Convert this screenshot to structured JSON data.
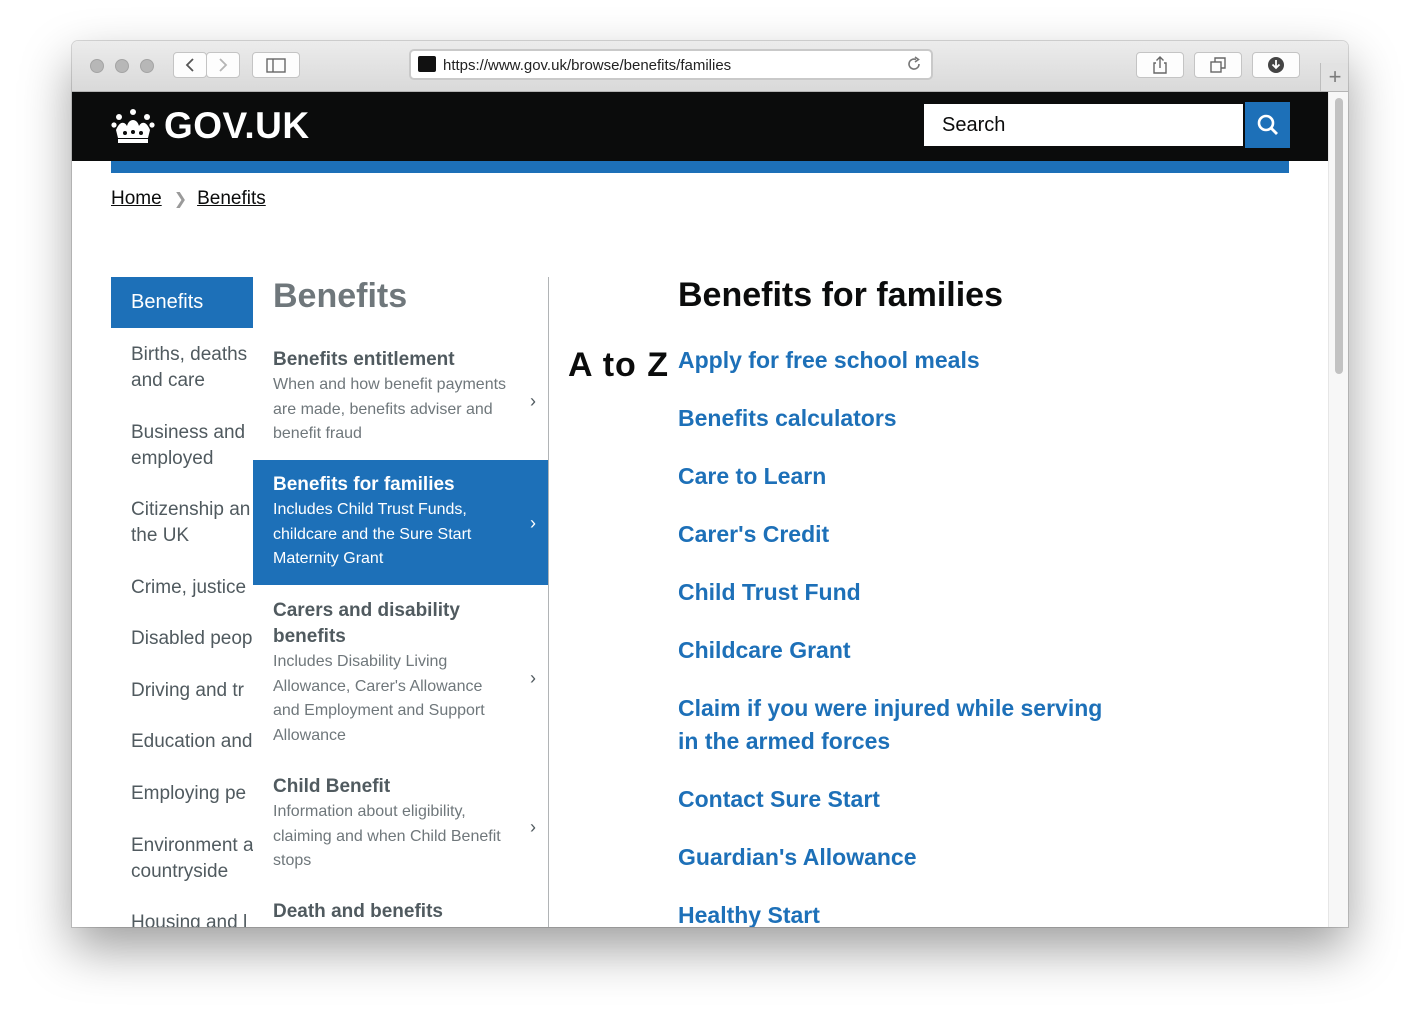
{
  "browser": {
    "url": "https://www.gov.uk/browse/benefits/families"
  },
  "header": {
    "logo_text": "GOV.UK",
    "search_placeholder": "Search"
  },
  "breadcrumb": {
    "items": [
      "Home",
      "Benefits"
    ]
  },
  "col1": {
    "active": "Benefits",
    "items": [
      "Births, deaths\nand care",
      "Business and\nemployed",
      "Citizenship an\nthe UK",
      "Crime, justice",
      "Disabled peop",
      "Driving and tr",
      "Education and",
      "Employing pe",
      "Environment a\ncountryside",
      "Housing and l"
    ]
  },
  "col2": {
    "heading": "Benefits",
    "items": [
      {
        "title": "Benefits entitlement",
        "desc": "When and how benefit payments are made, benefits adviser and benefit fraud"
      },
      {
        "title": "Benefits for families",
        "desc": "Includes Child Trust Funds, childcare and the Sure Start Maternity Grant"
      },
      {
        "title": "Carers and disability benefits",
        "desc": "Includes Disability Living Allowance, Carer's Allowance and Employment and Support Allowance"
      },
      {
        "title": "Child Benefit",
        "desc": "Information about eligibility, claiming and when Child Benefit stops"
      },
      {
        "title": "Death and benefits",
        "desc": ""
      }
    ]
  },
  "col3": {
    "atoz": "A to Z",
    "title": "Benefits for families",
    "links": [
      "Apply for free school meals",
      "Benefits calculators",
      "Care to Learn",
      "Carer's Credit",
      "Child Trust Fund",
      "Childcare Grant",
      "Claim if you were injured while serving in the armed forces",
      "Contact Sure Start",
      "Guardian's Allowance",
      "Healthy Start"
    ]
  },
  "colors": {
    "govuk_blue": "#1d70b8",
    "header_black": "#0b0c0c",
    "secondary_text": "#505a5f"
  }
}
